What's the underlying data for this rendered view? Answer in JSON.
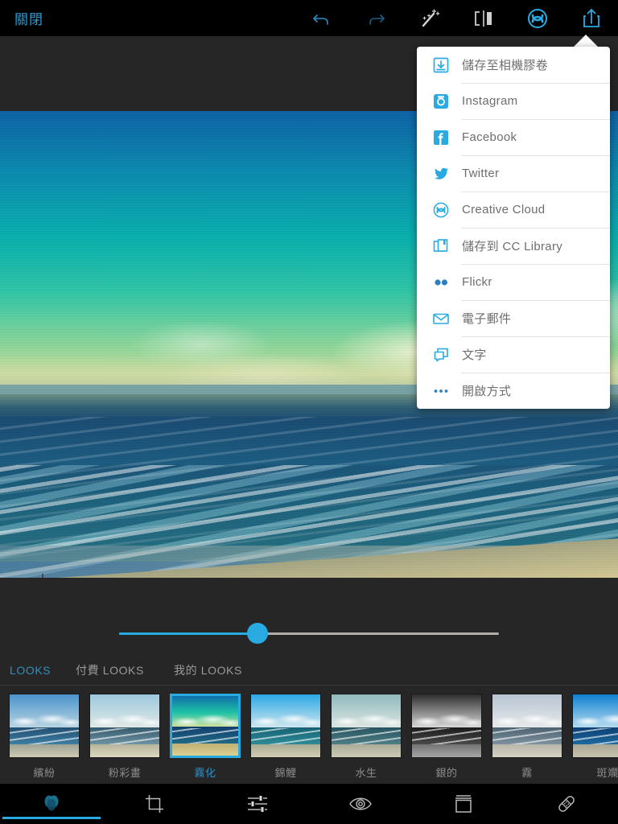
{
  "topbar": {
    "close_label": "關閉",
    "icons": [
      {
        "name": "undo-icon",
        "label": "復原"
      },
      {
        "name": "redo-icon",
        "label": "重做"
      },
      {
        "name": "magic-wand-icon",
        "label": "自動修正"
      },
      {
        "name": "before-after-icon",
        "label": "比較前後"
      },
      {
        "name": "creative-cloud-icon",
        "label": "Creative Cloud"
      },
      {
        "name": "share-icon",
        "label": "分享"
      }
    ]
  },
  "share_menu": {
    "items": [
      {
        "icon": "save-to-camera-roll-icon",
        "label": "儲存至相機膠卷"
      },
      {
        "icon": "instagram-icon",
        "label": "Instagram"
      },
      {
        "icon": "facebook-icon",
        "label": "Facebook"
      },
      {
        "icon": "twitter-icon",
        "label": "Twitter"
      },
      {
        "icon": "creative-cloud-icon",
        "label": "Creative Cloud"
      },
      {
        "icon": "cc-library-icon",
        "label": "儲存到 CC Library"
      },
      {
        "icon": "flickr-icon",
        "label": "Flickr"
      },
      {
        "icon": "email-icon",
        "label": "電子郵件"
      },
      {
        "icon": "message-icon",
        "label": "文字"
      },
      {
        "icon": "more-icon",
        "label": "開啟方式"
      }
    ]
  },
  "slider": {
    "name": "intensity-slider",
    "value_percent": 36
  },
  "tabs": [
    {
      "label": "LOOKS",
      "active": true
    },
    {
      "label": "付費 LOOKS",
      "active": false
    },
    {
      "label": "我的 LOOKS",
      "active": false
    }
  ],
  "looks": [
    {
      "label": "繽紛",
      "selected": false,
      "sky": "#5b9fd0",
      "sea": "#2a5d85",
      "sand": "#c9c4ae"
    },
    {
      "label": "粉彩畫",
      "selected": false,
      "sky": "#a8cfe0",
      "sea": "#3e6a7d",
      "sand": "#d8d2b8"
    },
    {
      "label": "霧化",
      "selected": true,
      "sky": "#18b5a8",
      "sea": "#16467a",
      "sand": "#d8c981"
    },
    {
      "label": "錦鯉",
      "selected": false,
      "sky": "#3fb3e8",
      "sea": "#1d7f96",
      "sand": "#cfcaae"
    },
    {
      "label": "水生",
      "selected": false,
      "sky": "#9dc6c6",
      "sea": "#2f6773",
      "sand": "#c8c6b0"
    },
    {
      "label": "銀的",
      "selected": false,
      "sky": "#c9c9c9",
      "sea": "#3a3a3a",
      "sand": "#8e8e8e"
    },
    {
      "label": "霧",
      "selected": false,
      "sky": "#c2cdd6",
      "sea": "#5e7180",
      "sand": "#cdc9bb"
    },
    {
      "label": "斑斕",
      "selected": false,
      "sky": "#1f8fe0",
      "sea": "#104a7d",
      "sand": "#bdbaa6"
    }
  ],
  "bottom_toolbar": [
    {
      "icon": "looks-icon",
      "label": "LOOKS",
      "active": true
    },
    {
      "icon": "crop-icon",
      "label": "裁切",
      "active": false
    },
    {
      "icon": "adjust-sliders-icon",
      "label": "調整",
      "active": false
    },
    {
      "icon": "eye-selective-icon",
      "label": "選取性",
      "active": false
    },
    {
      "icon": "frame-icon",
      "label": "邊框",
      "active": false
    },
    {
      "icon": "heal-bandage-icon",
      "label": "修復",
      "active": false
    }
  ]
}
